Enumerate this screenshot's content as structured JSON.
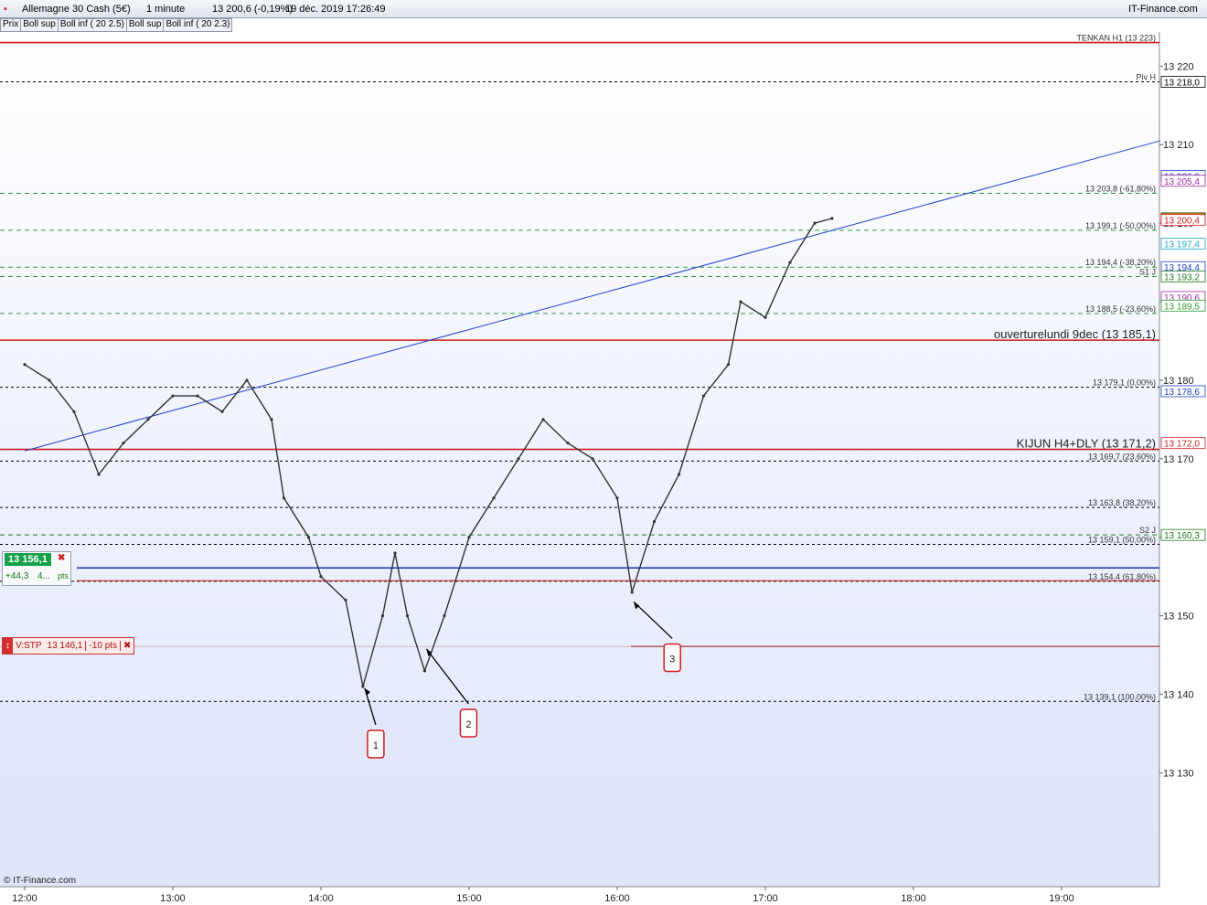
{
  "header": {
    "instrument": "Allemagne 30 Cash (5€)",
    "interval": "1 minute",
    "quote": "13 200,6 (-0,19%)",
    "datetime": "19 déc. 2019 17:26:49",
    "brand": "IT-Finance.com"
  },
  "indicators": [
    "Prix",
    "Boll sup",
    "Boll inf ( 20 2.5)",
    "Boll sup",
    "Boll inf ( 20 2.3)"
  ],
  "position": {
    "price": "13 156,1",
    "gain": "+44,3",
    "qty": "4...",
    "unit": "pts",
    "close_symbol": "✖"
  },
  "stop": {
    "label": "V:STP",
    "price": "13 146,1",
    "dist": "-10 pts",
    "close_symbol": "✖"
  },
  "footer": "© IT-Finance.com",
  "chart_data": {
    "type": "line",
    "x_ticks": [
      "12:00",
      "13:00",
      "14:00",
      "15:00",
      "16:00",
      "17:00",
      "18:00",
      "19:00"
    ],
    "y_ticks": [
      "13 130",
      "13 140",
      "13 150",
      "13 160",
      "13 170",
      "13 180",
      "13 190",
      "13 200",
      "13 210",
      "13 220"
    ],
    "ylim": [
      13120,
      13226
    ],
    "levels": [
      {
        "label": "TENKAN H1 (13 223)",
        "value": 13223,
        "color": "#d01c1c",
        "style": "solid"
      },
      {
        "label": "Piv H",
        "value": 13218.0,
        "color": "#000000",
        "style": "dash"
      },
      {
        "label": "13 203,8 (-61,80%)",
        "value": 13203.8,
        "color": "#2e9e2e",
        "style": "dash"
      },
      {
        "label": "13 199,1 (-50,00%)",
        "value": 13199.1,
        "color": "#2e9e2e",
        "style": "dash"
      },
      {
        "label": "13 194,4 (-38,20%)",
        "value": 13194.4,
        "color": "#2e9e2e",
        "style": "dash"
      },
      {
        "label": "S1 J",
        "value": 13193.2,
        "color": "#2e9e2e",
        "style": "dash"
      },
      {
        "label": "13 188,5 (-23,60%)",
        "value": 13188.5,
        "color": "#2e9e2e",
        "style": "dash"
      },
      {
        "label": "ouverturelundi 9dec (13 185,1)",
        "value": 13185.1,
        "color": "#d01c1c",
        "style": "solid"
      },
      {
        "label": "13 179,1 (0,00%)",
        "value": 13179.1,
        "color": "#000000",
        "style": "dash"
      },
      {
        "label": "KIJUN H4+DLY (13 171,2)",
        "value": 13171.2,
        "color": "#d01c1c",
        "style": "solid"
      },
      {
        "label": "13 169,7 (23,60%)",
        "value": 13169.7,
        "color": "#000000",
        "style": "dash"
      },
      {
        "label": "13 163,8 (38,20%)",
        "value": 13163.8,
        "color": "#000000",
        "style": "dash"
      },
      {
        "label": "S2 J",
        "value": 13160.3,
        "color": "#1f7a1f",
        "style": "dash"
      },
      {
        "label": "13 159,1 (50,00%)",
        "value": 13159.1,
        "color": "#000000",
        "style": "dash"
      },
      {
        "label": "13 154,4 (61,80%)",
        "value": 13154.4,
        "color": "#000000",
        "style": "dash"
      },
      {
        "label": "13 139,1 (100,00%)",
        "value": 13139.1,
        "color": "#000000",
        "style": "dash"
      }
    ],
    "price_tags": [
      {
        "label": "13 218,0",
        "value": 13218.0,
        "color": "#000000",
        "bg": "#ffffff"
      },
      {
        "label": "13 206,0",
        "value": 13206.0,
        "color": "#1c3fd1",
        "bg": "#ffffff"
      },
      {
        "label": "13 205,4",
        "value": 13205.4,
        "color": "#a02aa0",
        "bg": "#ffffff"
      },
      {
        "label": "13 200,6",
        "value": 13200.6,
        "color": "#000000",
        "bg": "#f0c419"
      },
      {
        "label": "13 200,4",
        "value": 13200.4,
        "color": "#d01c1c",
        "bg": "#ffffff"
      },
      {
        "label": "13 197,4",
        "value": 13197.4,
        "color": "#19a7c9",
        "bg": "#ffffff"
      },
      {
        "label": "13 194,4",
        "value": 13194.4,
        "color": "#1c3fd1",
        "bg": "#ffffff"
      },
      {
        "label": "13 193,2",
        "value": 13193.2,
        "color": "#1f7a1f",
        "bg": "#ffffff"
      },
      {
        "label": "13 190,6",
        "value": 13190.6,
        "color": "#a02aa0",
        "bg": "#ffffff"
      },
      {
        "label": "13 189,5",
        "value": 13189.5,
        "color": "#2e9e2e",
        "bg": "#ffffff"
      },
      {
        "label": "13 178,6",
        "value": 13178.6,
        "color": "#1c3fd1",
        "bg": "#ffffff"
      },
      {
        "label": "13 172,0",
        "value": 13172.0,
        "color": "#d01c1c",
        "bg": "#ffffff"
      },
      {
        "label": "13 160,3",
        "value": 13160.3,
        "color": "#1f7a1f",
        "bg": "#ffffff"
      }
    ],
    "trendline": {
      "from": {
        "time": "12:00",
        "value": 13171
      },
      "to": {
        "time": "19:40",
        "value": 13210.5
      },
      "color": "#1c3fd1"
    },
    "stop_line": 13146.1,
    "position_line": 13156.1,
    "annotations": [
      {
        "label": "1",
        "time": "14:17",
        "value": 13141
      },
      {
        "label": "2",
        "time": "14:42",
        "value": 13146
      },
      {
        "label": "3",
        "time": "16:06",
        "value": 13152
      }
    ],
    "series": [
      {
        "name": "Prix",
        "color": "#333333",
        "points": [
          [
            "12:00",
            13182
          ],
          [
            "12:10",
            13180
          ],
          [
            "12:20",
            13176
          ],
          [
            "12:30",
            13168
          ],
          [
            "12:40",
            13172
          ],
          [
            "12:50",
            13175
          ],
          [
            "13:00",
            13178
          ],
          [
            "13:10",
            13178
          ],
          [
            "13:20",
            13176
          ],
          [
            "13:30",
            13180
          ],
          [
            "13:40",
            13175
          ],
          [
            "13:45",
            13165
          ],
          [
            "13:55",
            13160
          ],
          [
            "14:00",
            13155
          ],
          [
            "14:10",
            13152
          ],
          [
            "14:17",
            13141
          ],
          [
            "14:25",
            13150
          ],
          [
            "14:30",
            13158
          ],
          [
            "14:35",
            13150
          ],
          [
            "14:42",
            13143
          ],
          [
            "14:50",
            13150
          ],
          [
            "15:00",
            13160
          ],
          [
            "15:10",
            13165
          ],
          [
            "15:20",
            13170
          ],
          [
            "15:30",
            13175
          ],
          [
            "15:40",
            13172
          ],
          [
            "15:50",
            13170
          ],
          [
            "16:00",
            13165
          ],
          [
            "16:06",
            13153
          ],
          [
            "16:15",
            13162
          ],
          [
            "16:25",
            13168
          ],
          [
            "16:35",
            13178
          ],
          [
            "16:45",
            13182
          ],
          [
            "16:50",
            13190
          ],
          [
            "17:00",
            13188
          ],
          [
            "17:10",
            13195
          ],
          [
            "17:20",
            13200
          ],
          [
            "17:27",
            13200.6
          ]
        ]
      }
    ]
  }
}
